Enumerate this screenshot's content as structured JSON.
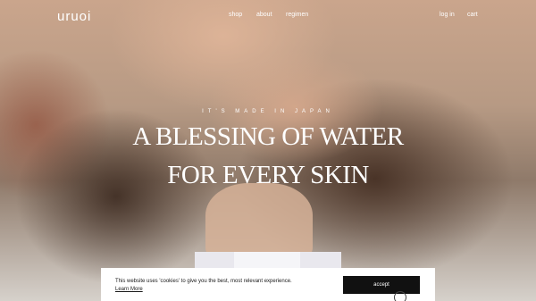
{
  "header": {
    "logo": "uruoi",
    "nav": {
      "shop": "shop",
      "about": "about",
      "regimen": "regimen",
      "login": "log in",
      "cart": "cart"
    }
  },
  "hero": {
    "eyebrow": "IT'S MADE IN JAPAN",
    "headline_line1": "A BLESSING OF WATER",
    "headline_line2": "FOR EVERY SKIN"
  },
  "cookie_banner": {
    "message": "This website uses 'cookies' to give you the best, most relevant experience.",
    "link_label": "Learn More",
    "accept_label": "accept"
  },
  "colors": {
    "text_on_hero": "#ffffff",
    "banner_bg": "#ffffff",
    "accept_bg": "#111111"
  }
}
